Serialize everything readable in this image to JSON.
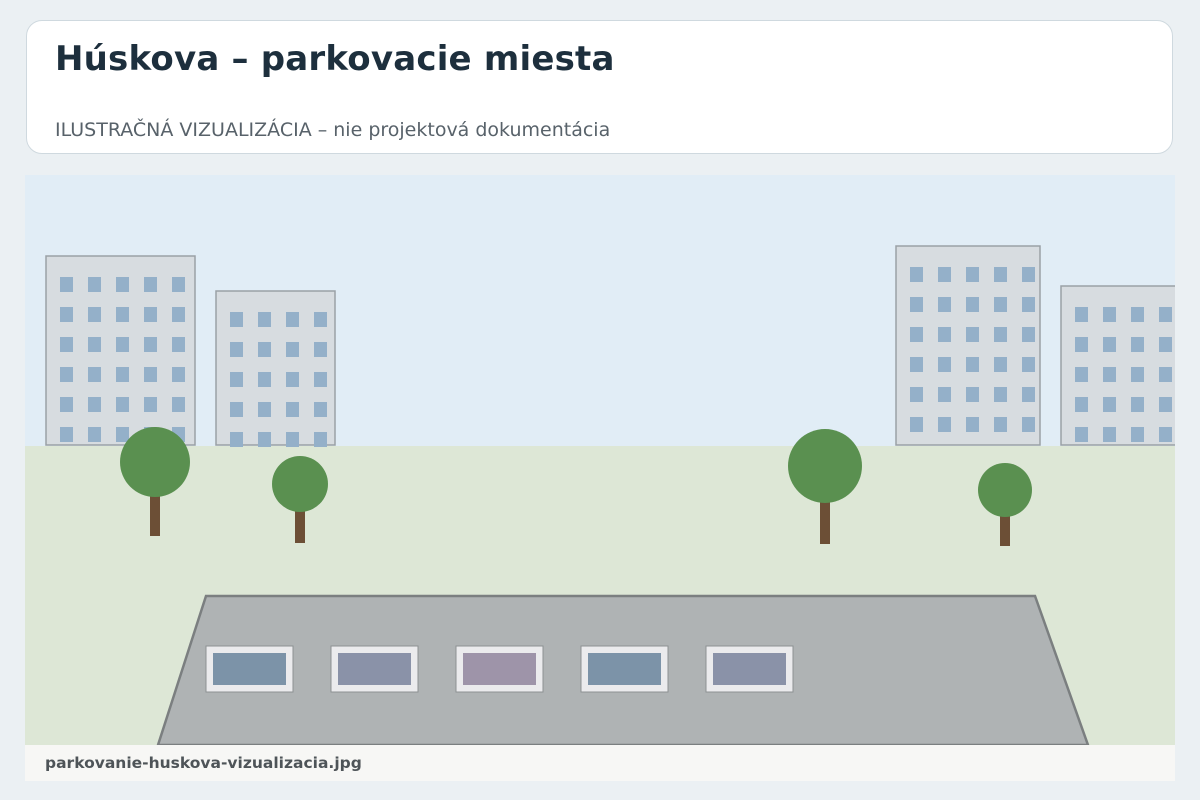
{
  "header": {
    "title": "Húskova – parkovacie miesta",
    "subtitle": "ILUSTRAČNÁ VIZUALIZÁCIA – nie projektová dokumentácia"
  },
  "illustration": {
    "colors": {
      "sky": "#e1edf6",
      "grass": "#dde7d6",
      "building": "#d7dce0",
      "building_edge": "#9aa1a6",
      "window": "#94b0c9",
      "tree_crown": "#5a9050",
      "tree_trunk": "#6c4f36",
      "parking_lot": "#afb3b4",
      "parking_lot_edge": "#7b7f80",
      "parking_spot": "#ebebed"
    },
    "parked_cars": [
      {
        "color": "#7c93a8"
      },
      {
        "color": "#8a92a8"
      },
      {
        "color": "#9e94a9"
      },
      {
        "color": "#7c93a8"
      },
      {
        "color": "#8a92a8"
      }
    ]
  },
  "caption": {
    "filename": "parkovanie-huskova-vizualizacia.jpg"
  }
}
